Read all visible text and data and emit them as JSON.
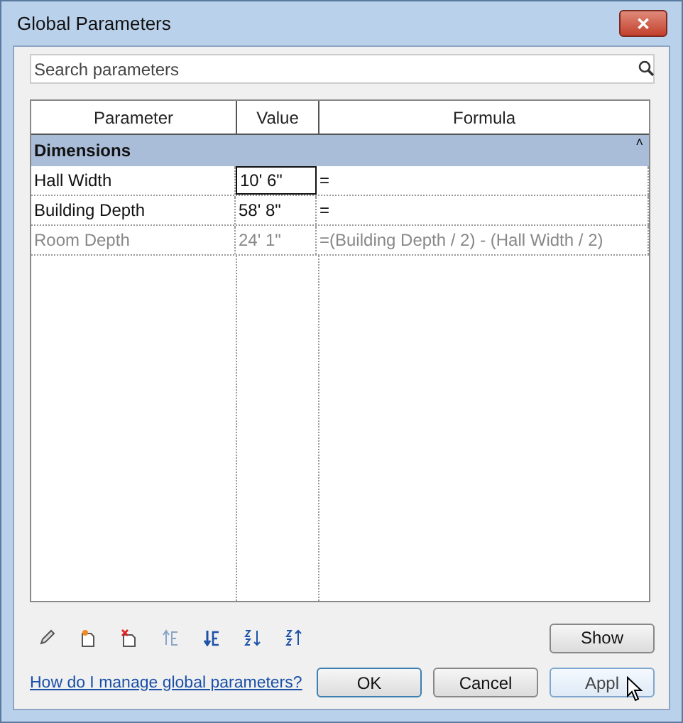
{
  "window": {
    "title": "Global Parameters",
    "close": "✕"
  },
  "search": {
    "placeholder": "Search parameters"
  },
  "table": {
    "columns": [
      "Parameter",
      "Value",
      "Formula"
    ],
    "groups": [
      {
        "name": "Dimensions",
        "collapse": "˄",
        "rows": [
          {
            "parameter": "Hall Width",
            "value": "10'  6\"",
            "formula": "=",
            "disabled": false,
            "selected": true
          },
          {
            "parameter": "Building Depth",
            "value": "58'  8\"",
            "formula": "=",
            "disabled": false,
            "selected": false
          },
          {
            "parameter": "Room Depth",
            "value": "24'  1\"",
            "formula": "=(Building Depth / 2) - (Hall Width / 2)",
            "disabled": true,
            "selected": false
          }
        ]
      }
    ]
  },
  "toolbar": [
    {
      "kind": "edit"
    },
    {
      "kind": "new"
    },
    {
      "kind": "delete"
    },
    {
      "kind": "up"
    },
    {
      "kind": "down"
    },
    {
      "kind": "sort-asc"
    },
    {
      "kind": "sort-desc"
    }
  ],
  "show_button": "Show",
  "help_link": "How do I manage global parameters?",
  "buttons": [
    "OK",
    "Cancel",
    "Appl"
  ]
}
